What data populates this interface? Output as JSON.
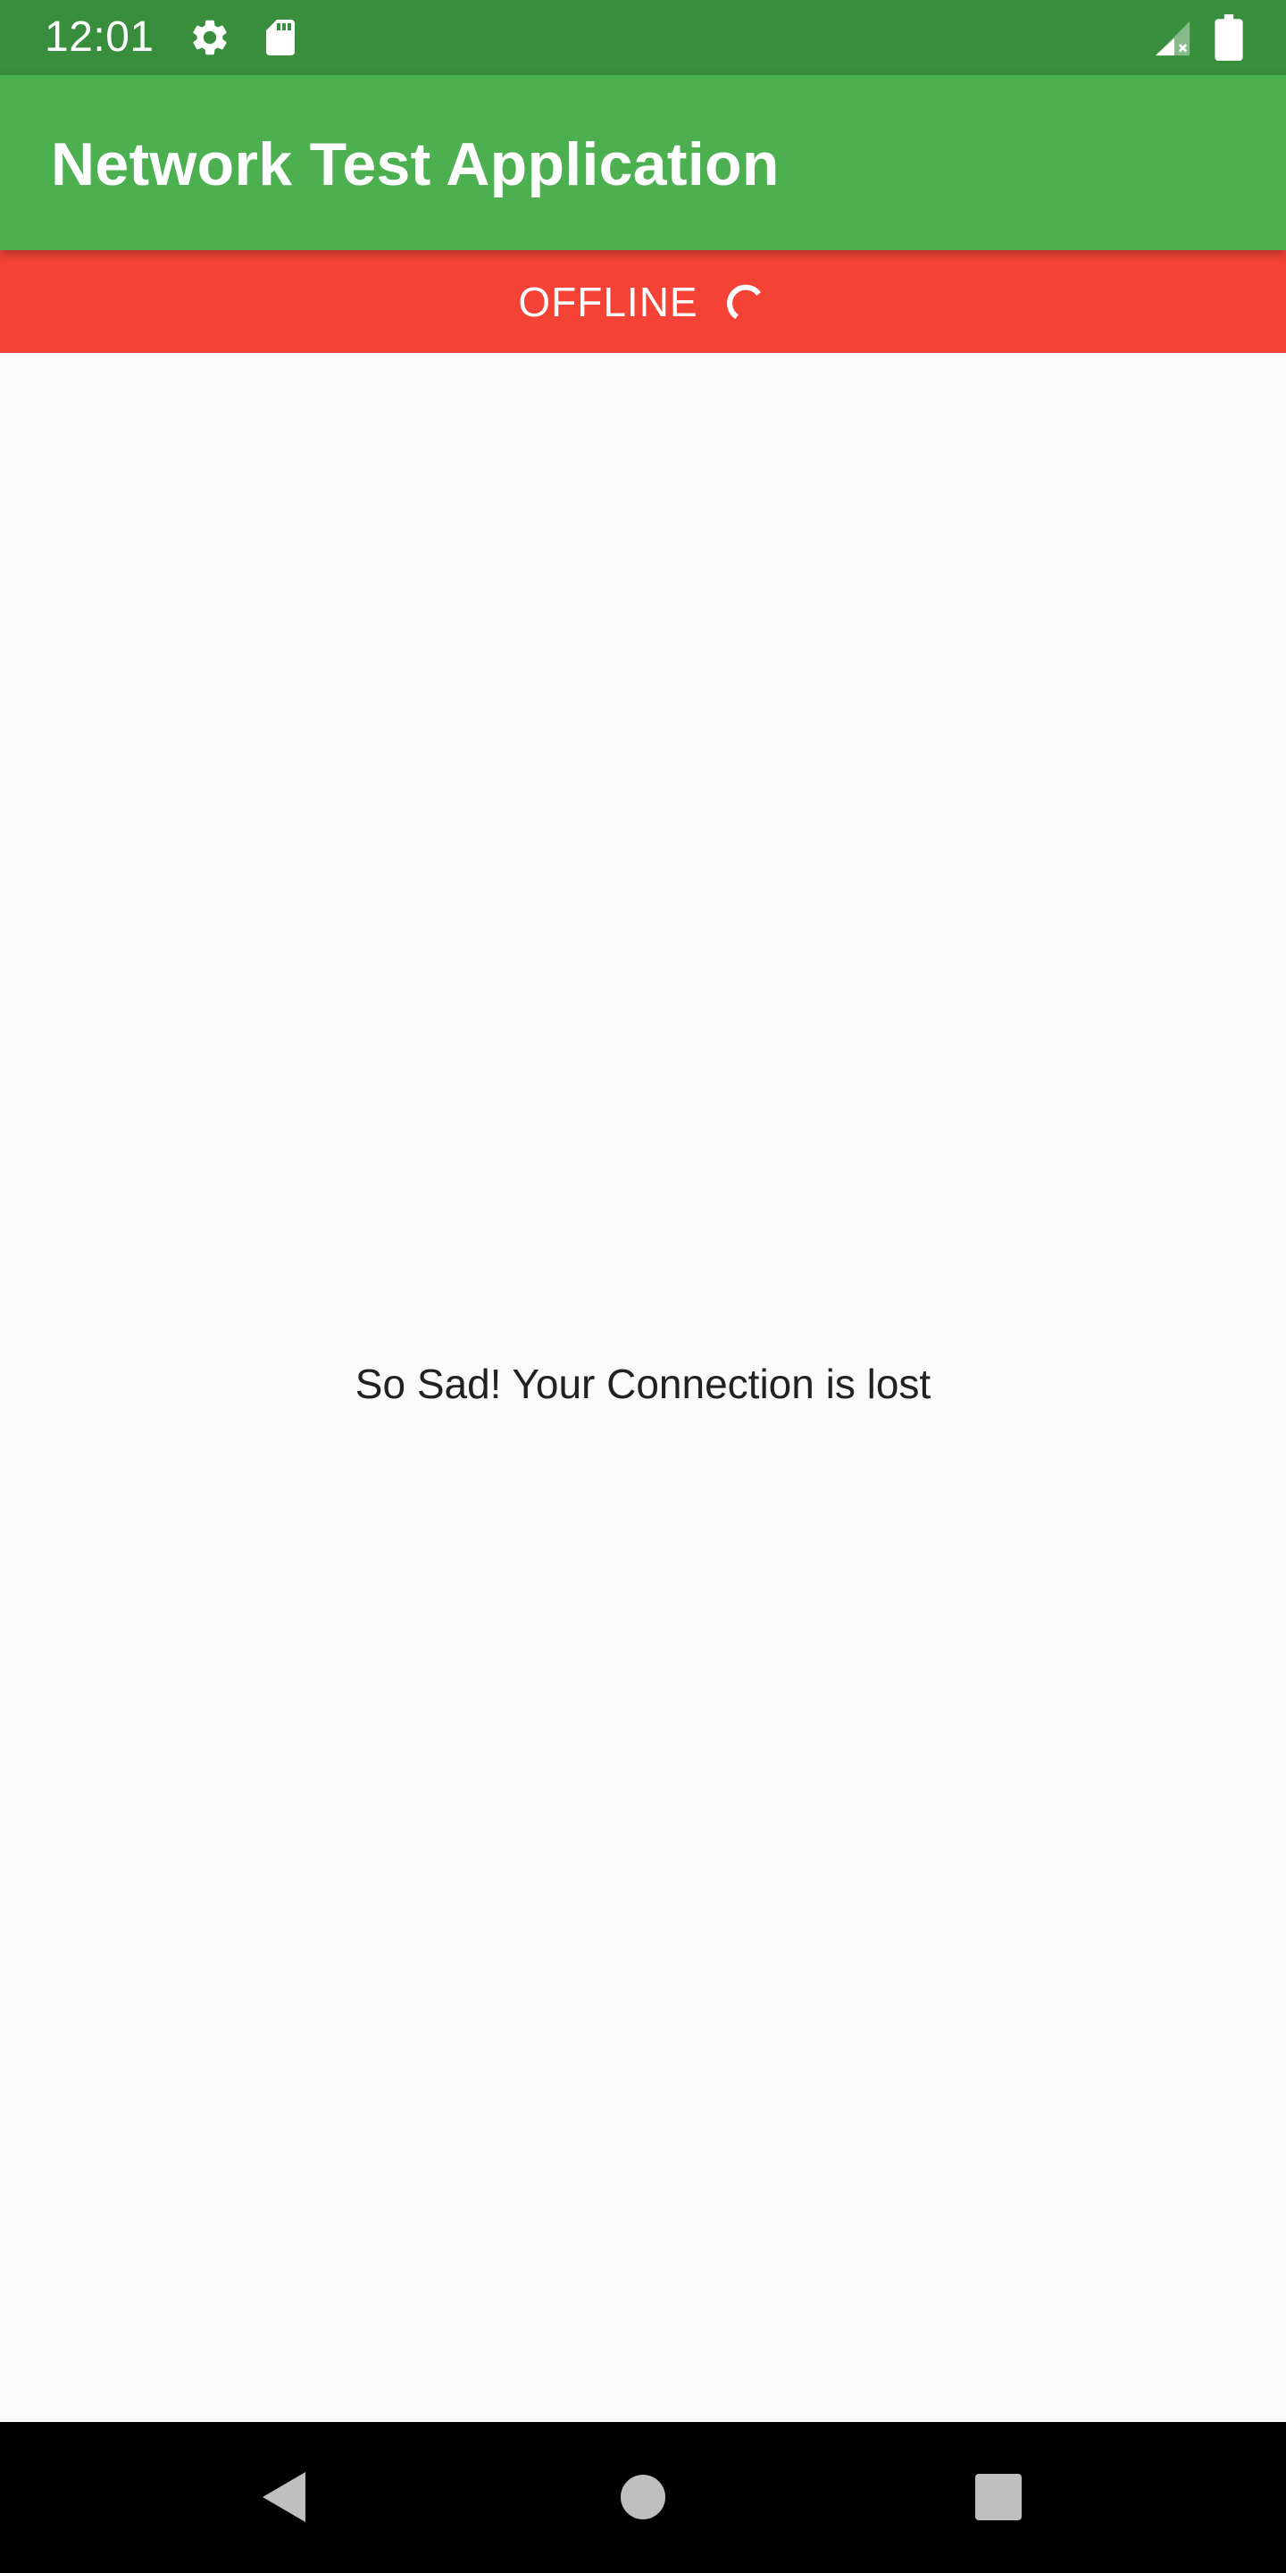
{
  "status_bar": {
    "time": "12:01",
    "icons": [
      "settings-gear-icon",
      "sd-card-icon",
      "signal-no-connection-icon",
      "battery-full-icon"
    ],
    "background_color": "#388e3c"
  },
  "app_bar": {
    "title": "Network Test Application",
    "background_color": "#4caf50"
  },
  "connection_banner": {
    "label": "OFFLINE",
    "icon": "loading-spinner-icon",
    "background_color": "#f44336"
  },
  "content": {
    "message": "So Sad! Your Connection is lost"
  },
  "nav_bar": {
    "buttons": [
      "back-triangle-icon",
      "home-circle-icon",
      "recents-square-icon"
    ]
  }
}
